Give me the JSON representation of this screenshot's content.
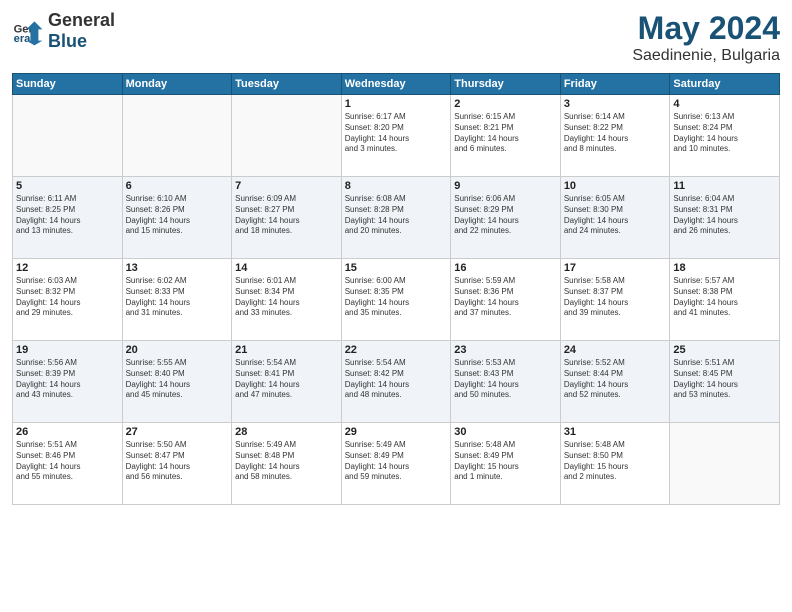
{
  "header": {
    "logo_general": "General",
    "logo_blue": "Blue",
    "month": "May 2024",
    "location": "Saedinenie, Bulgaria"
  },
  "weekdays": [
    "Sunday",
    "Monday",
    "Tuesday",
    "Wednesday",
    "Thursday",
    "Friday",
    "Saturday"
  ],
  "weeks": [
    [
      {
        "day": "",
        "info": ""
      },
      {
        "day": "",
        "info": ""
      },
      {
        "day": "",
        "info": ""
      },
      {
        "day": "1",
        "info": "Sunrise: 6:17 AM\nSunset: 8:20 PM\nDaylight: 14 hours\nand 3 minutes."
      },
      {
        "day": "2",
        "info": "Sunrise: 6:15 AM\nSunset: 8:21 PM\nDaylight: 14 hours\nand 6 minutes."
      },
      {
        "day": "3",
        "info": "Sunrise: 6:14 AM\nSunset: 8:22 PM\nDaylight: 14 hours\nand 8 minutes."
      },
      {
        "day": "4",
        "info": "Sunrise: 6:13 AM\nSunset: 8:24 PM\nDaylight: 14 hours\nand 10 minutes."
      }
    ],
    [
      {
        "day": "5",
        "info": "Sunrise: 6:11 AM\nSunset: 8:25 PM\nDaylight: 14 hours\nand 13 minutes."
      },
      {
        "day": "6",
        "info": "Sunrise: 6:10 AM\nSunset: 8:26 PM\nDaylight: 14 hours\nand 15 minutes."
      },
      {
        "day": "7",
        "info": "Sunrise: 6:09 AM\nSunset: 8:27 PM\nDaylight: 14 hours\nand 18 minutes."
      },
      {
        "day": "8",
        "info": "Sunrise: 6:08 AM\nSunset: 8:28 PM\nDaylight: 14 hours\nand 20 minutes."
      },
      {
        "day": "9",
        "info": "Sunrise: 6:06 AM\nSunset: 8:29 PM\nDaylight: 14 hours\nand 22 minutes."
      },
      {
        "day": "10",
        "info": "Sunrise: 6:05 AM\nSunset: 8:30 PM\nDaylight: 14 hours\nand 24 minutes."
      },
      {
        "day": "11",
        "info": "Sunrise: 6:04 AM\nSunset: 8:31 PM\nDaylight: 14 hours\nand 26 minutes."
      }
    ],
    [
      {
        "day": "12",
        "info": "Sunrise: 6:03 AM\nSunset: 8:32 PM\nDaylight: 14 hours\nand 29 minutes."
      },
      {
        "day": "13",
        "info": "Sunrise: 6:02 AM\nSunset: 8:33 PM\nDaylight: 14 hours\nand 31 minutes."
      },
      {
        "day": "14",
        "info": "Sunrise: 6:01 AM\nSunset: 8:34 PM\nDaylight: 14 hours\nand 33 minutes."
      },
      {
        "day": "15",
        "info": "Sunrise: 6:00 AM\nSunset: 8:35 PM\nDaylight: 14 hours\nand 35 minutes."
      },
      {
        "day": "16",
        "info": "Sunrise: 5:59 AM\nSunset: 8:36 PM\nDaylight: 14 hours\nand 37 minutes."
      },
      {
        "day": "17",
        "info": "Sunrise: 5:58 AM\nSunset: 8:37 PM\nDaylight: 14 hours\nand 39 minutes."
      },
      {
        "day": "18",
        "info": "Sunrise: 5:57 AM\nSunset: 8:38 PM\nDaylight: 14 hours\nand 41 minutes."
      }
    ],
    [
      {
        "day": "19",
        "info": "Sunrise: 5:56 AM\nSunset: 8:39 PM\nDaylight: 14 hours\nand 43 minutes."
      },
      {
        "day": "20",
        "info": "Sunrise: 5:55 AM\nSunset: 8:40 PM\nDaylight: 14 hours\nand 45 minutes."
      },
      {
        "day": "21",
        "info": "Sunrise: 5:54 AM\nSunset: 8:41 PM\nDaylight: 14 hours\nand 47 minutes."
      },
      {
        "day": "22",
        "info": "Sunrise: 5:54 AM\nSunset: 8:42 PM\nDaylight: 14 hours\nand 48 minutes."
      },
      {
        "day": "23",
        "info": "Sunrise: 5:53 AM\nSunset: 8:43 PM\nDaylight: 14 hours\nand 50 minutes."
      },
      {
        "day": "24",
        "info": "Sunrise: 5:52 AM\nSunset: 8:44 PM\nDaylight: 14 hours\nand 52 minutes."
      },
      {
        "day": "25",
        "info": "Sunrise: 5:51 AM\nSunset: 8:45 PM\nDaylight: 14 hours\nand 53 minutes."
      }
    ],
    [
      {
        "day": "26",
        "info": "Sunrise: 5:51 AM\nSunset: 8:46 PM\nDaylight: 14 hours\nand 55 minutes."
      },
      {
        "day": "27",
        "info": "Sunrise: 5:50 AM\nSunset: 8:47 PM\nDaylight: 14 hours\nand 56 minutes."
      },
      {
        "day": "28",
        "info": "Sunrise: 5:49 AM\nSunset: 8:48 PM\nDaylight: 14 hours\nand 58 minutes."
      },
      {
        "day": "29",
        "info": "Sunrise: 5:49 AM\nSunset: 8:49 PM\nDaylight: 14 hours\nand 59 minutes."
      },
      {
        "day": "30",
        "info": "Sunrise: 5:48 AM\nSunset: 8:49 PM\nDaylight: 15 hours\nand 1 minute."
      },
      {
        "day": "31",
        "info": "Sunrise: 5:48 AM\nSunset: 8:50 PM\nDaylight: 15 hours\nand 2 minutes."
      },
      {
        "day": "",
        "info": ""
      }
    ]
  ]
}
